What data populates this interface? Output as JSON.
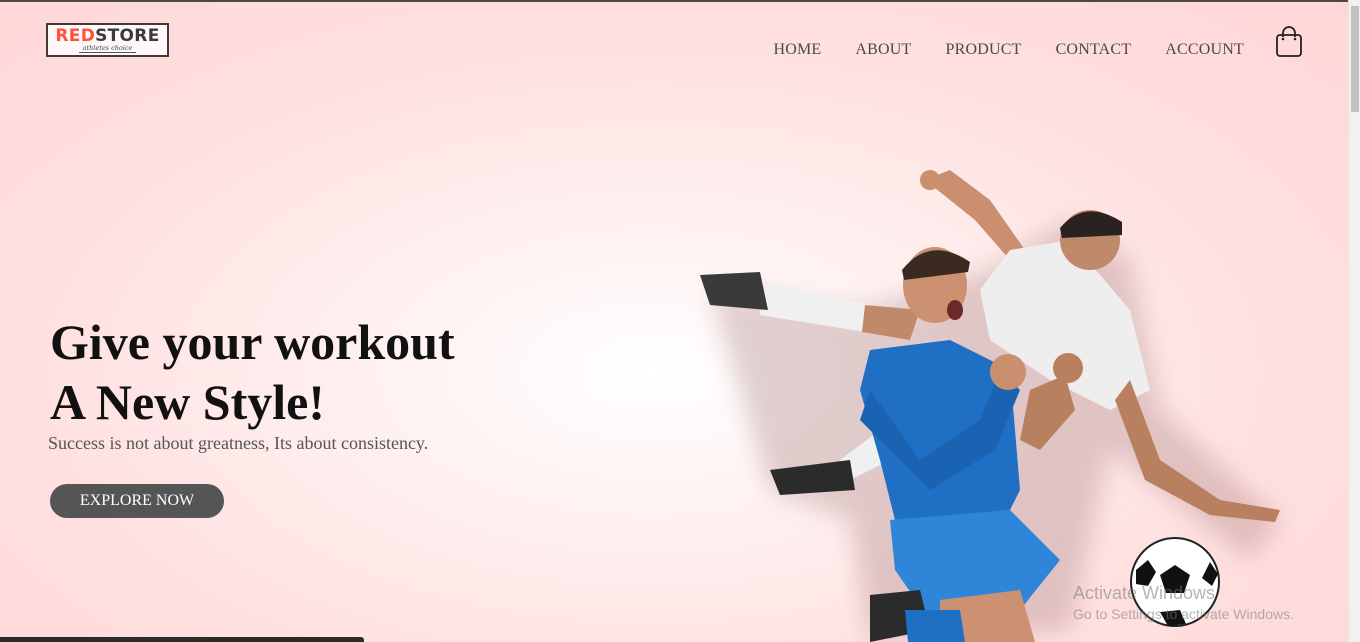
{
  "brand": {
    "name_part1": "RED",
    "name_part2": "STORE",
    "tagline": "athletes choice"
  },
  "nav": {
    "items": [
      {
        "label": "HOME"
      },
      {
        "label": "ABOUT"
      },
      {
        "label": "PRODUCT"
      },
      {
        "label": "CONTACT"
      },
      {
        "label": "ACCOUNT"
      }
    ],
    "cart_icon": "shopping-bag-icon"
  },
  "hero": {
    "title_line1": "Give your workout",
    "title_line2": "A New Style!",
    "subtitle": "Success is not about greatness, Its about consistency.",
    "cta_label": "EXPLORE NOW",
    "image": "football-players-image"
  },
  "watermark": {
    "title": "Activate Windows",
    "subtitle": "Go to Settings to activate Windows."
  },
  "colors": {
    "accent": "#ff523b",
    "button": "#555555",
    "background": "#ffe0e0"
  }
}
